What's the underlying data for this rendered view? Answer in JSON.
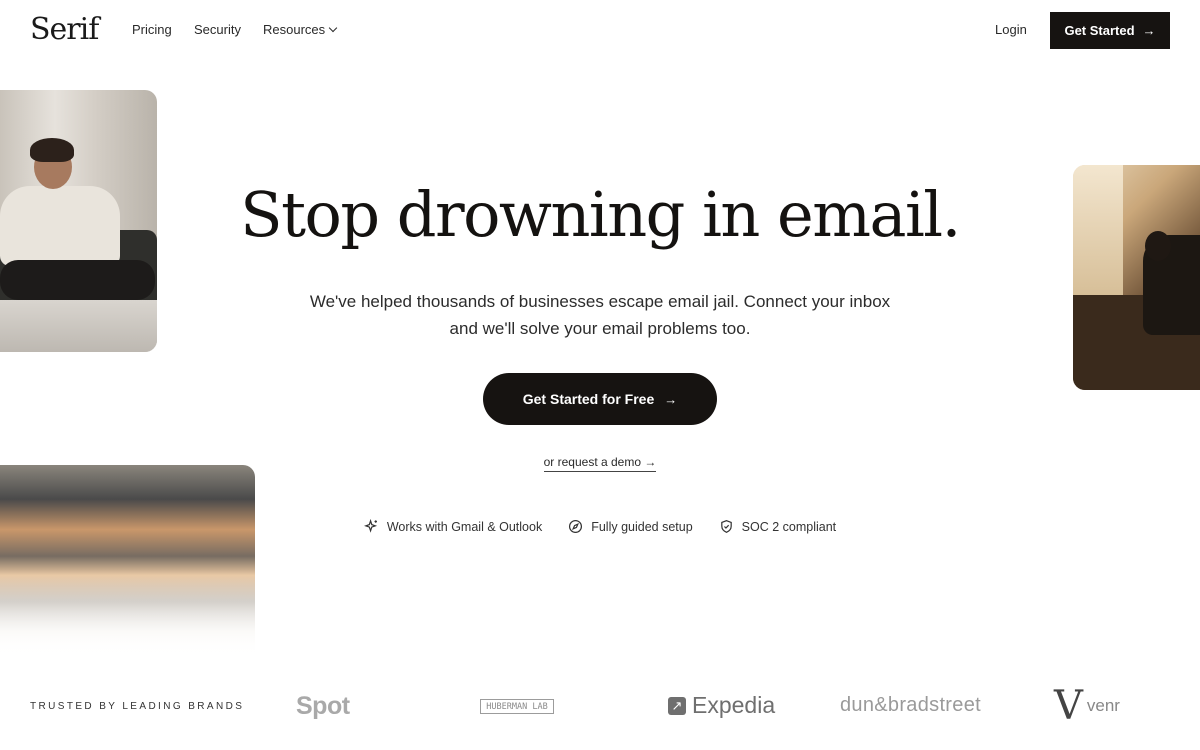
{
  "nav": {
    "logo": "Serif",
    "links": [
      "Pricing",
      "Security",
      "Resources"
    ],
    "login": "Login",
    "cta": "Get Started",
    "cta_icon": "arrow-right-icon",
    "resources_icon": "chevron-down-icon"
  },
  "hero": {
    "title": "Stop drowning in email.",
    "subtitle_line1": "We've helped thousands of businesses escape email jail. Connect your inbox",
    "subtitle_line2": "and we'll solve your email problems too.",
    "cta": "Get Started for Free",
    "demo_link": "or request a demo →"
  },
  "features": [
    {
      "icon": "sparkle-icon",
      "label": "Works with Gmail & Outlook"
    },
    {
      "icon": "compass-icon",
      "label": "Fully guided setup"
    },
    {
      "icon": "shield-check-icon",
      "label": "SOC 2 compliant"
    }
  ],
  "brands": {
    "heading": "TRUSTED BY LEADING BRANDS",
    "items": [
      "Spot",
      "HUBERMAN LAB",
      "Expedia",
      "dun",
      "&",
      "bradstreet",
      "venr"
    ]
  },
  "colors": {
    "primary_button": "#161311",
    "text": "#1a1a1a",
    "background": "#ffffff"
  }
}
